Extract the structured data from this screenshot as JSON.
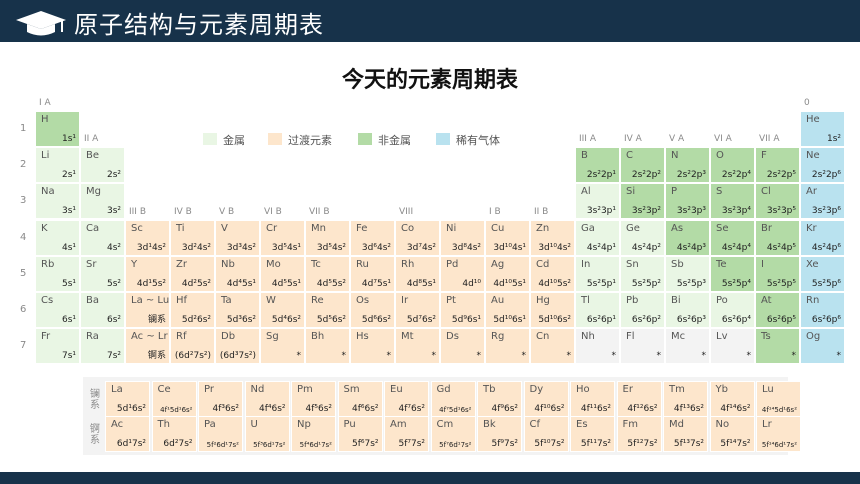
{
  "header": {
    "title": "原子结构与元素周期表"
  },
  "heading": "今天的元素周期表",
  "legend": [
    {
      "label": "金属",
      "color": "#e9f6e4"
    },
    {
      "label": "过渡元素",
      "color": "#fde6cc"
    },
    {
      "label": "非金属",
      "color": "#b3dba6"
    },
    {
      "label": "稀有气体",
      "color": "#b9e2ef"
    }
  ],
  "periods": [
    "1",
    "2",
    "3",
    "4",
    "5",
    "6",
    "7"
  ],
  "groups": [
    {
      "label": "I A",
      "col": 0,
      "row": 0
    },
    {
      "label": "II A",
      "col": 1,
      "row": 1
    },
    {
      "label": "III B",
      "col": 2,
      "row": 3
    },
    {
      "label": "IV B",
      "col": 3,
      "row": 3
    },
    {
      "label": "V B",
      "col": 4,
      "row": 3
    },
    {
      "label": "VI B",
      "col": 5,
      "row": 3
    },
    {
      "label": "VII B",
      "col": 6,
      "row": 3
    },
    {
      "label": "VIII",
      "col": 8,
      "row": 3
    },
    {
      "label": "I B",
      "col": 10,
      "row": 3
    },
    {
      "label": "II B",
      "col": 11,
      "row": 3
    },
    {
      "label": "III A",
      "col": 12,
      "row": 1
    },
    {
      "label": "IV A",
      "col": 13,
      "row": 1
    },
    {
      "label": "V A",
      "col": 14,
      "row": 1
    },
    {
      "label": "VI A",
      "col": 15,
      "row": 1
    },
    {
      "label": "VII A",
      "col": 16,
      "row": 1
    },
    {
      "label": "0",
      "col": 17,
      "row": 0
    }
  ],
  "elements": [
    {
      "s": "H",
      "c": "1s¹",
      "col": 0,
      "row": 0,
      "t": "nonmetal"
    },
    {
      "s": "He",
      "c": "1s²",
      "col": 17,
      "row": 0,
      "t": "noble"
    },
    {
      "s": "Li",
      "c": "2s¹",
      "col": 0,
      "row": 1,
      "t": "metal"
    },
    {
      "s": "Be",
      "c": "2s²",
      "col": 1,
      "row": 1,
      "t": "metal"
    },
    {
      "s": "B",
      "c": "2s²2p¹",
      "col": 12,
      "row": 1,
      "t": "nonmetal"
    },
    {
      "s": "C",
      "c": "2s²2p²",
      "col": 13,
      "row": 1,
      "t": "nonmetal"
    },
    {
      "s": "N",
      "c": "2s²2p³",
      "col": 14,
      "row": 1,
      "t": "nonmetal"
    },
    {
      "s": "O",
      "c": "2s²2p⁴",
      "col": 15,
      "row": 1,
      "t": "nonmetal"
    },
    {
      "s": "F",
      "c": "2s²2p⁵",
      "col": 16,
      "row": 1,
      "t": "nonmetal"
    },
    {
      "s": "Ne",
      "c": "2s²2p⁶",
      "col": 17,
      "row": 1,
      "t": "noble"
    },
    {
      "s": "Na",
      "c": "3s¹",
      "col": 0,
      "row": 2,
      "t": "metal"
    },
    {
      "s": "Mg",
      "c": "3s²",
      "col": 1,
      "row": 2,
      "t": "metal"
    },
    {
      "s": "Al",
      "c": "3s²3p¹",
      "col": 12,
      "row": 2,
      "t": "metal"
    },
    {
      "s": "Si",
      "c": "3s²3p²",
      "col": 13,
      "row": 2,
      "t": "nonmetal"
    },
    {
      "s": "P",
      "c": "3s²3p³",
      "col": 14,
      "row": 2,
      "t": "nonmetal"
    },
    {
      "s": "S",
      "c": "3s²3p⁴",
      "col": 15,
      "row": 2,
      "t": "nonmetal"
    },
    {
      "s": "Cl",
      "c": "3s²3p⁵",
      "col": 16,
      "row": 2,
      "t": "nonmetal"
    },
    {
      "s": "Ar",
      "c": "3s²3p⁶",
      "col": 17,
      "row": 2,
      "t": "noble"
    },
    {
      "s": "K",
      "c": "4s¹",
      "col": 0,
      "row": 3,
      "t": "metal"
    },
    {
      "s": "Ca",
      "c": "4s²",
      "col": 1,
      "row": 3,
      "t": "metal"
    },
    {
      "s": "Sc",
      "c": "3d¹4s²",
      "col": 2,
      "row": 3,
      "t": "trans"
    },
    {
      "s": "Ti",
      "c": "3d²4s²",
      "col": 3,
      "row": 3,
      "t": "trans"
    },
    {
      "s": "V",
      "c": "3d³4s²",
      "col": 4,
      "row": 3,
      "t": "trans"
    },
    {
      "s": "Cr",
      "c": "3d⁵4s¹",
      "col": 5,
      "row": 3,
      "t": "trans"
    },
    {
      "s": "Mn",
      "c": "3d⁵4s²",
      "col": 6,
      "row": 3,
      "t": "trans"
    },
    {
      "s": "Fe",
      "c": "3d⁶4s²",
      "col": 7,
      "row": 3,
      "t": "trans"
    },
    {
      "s": "Co",
      "c": "3d⁷4s²",
      "col": 8,
      "row": 3,
      "t": "trans"
    },
    {
      "s": "Ni",
      "c": "3d⁸4s²",
      "col": 9,
      "row": 3,
      "t": "trans"
    },
    {
      "s": "Cu",
      "c": "3d¹⁰4s¹",
      "col": 10,
      "row": 3,
      "t": "trans"
    },
    {
      "s": "Zn",
      "c": "3d¹⁰4s²",
      "col": 11,
      "row": 3,
      "t": "trans"
    },
    {
      "s": "Ga",
      "c": "4s²4p¹",
      "col": 12,
      "row": 3,
      "t": "metal"
    },
    {
      "s": "Ge",
      "c": "4s²4p²",
      "col": 13,
      "row": 3,
      "t": "metal"
    },
    {
      "s": "As",
      "c": "4s²4p³",
      "col": 14,
      "row": 3,
      "t": "nonmetal"
    },
    {
      "s": "Se",
      "c": "4s²4p⁴",
      "col": 15,
      "row": 3,
      "t": "nonmetal"
    },
    {
      "s": "Br",
      "c": "4s²4p⁵",
      "col": 16,
      "row": 3,
      "t": "nonmetal"
    },
    {
      "s": "Kr",
      "c": "4s²4p⁶",
      "col": 17,
      "row": 3,
      "t": "noble"
    },
    {
      "s": "Rb",
      "c": "5s¹",
      "col": 0,
      "row": 4,
      "t": "metal"
    },
    {
      "s": "Sr",
      "c": "5s²",
      "col": 1,
      "row": 4,
      "t": "metal"
    },
    {
      "s": "Y",
      "c": "4d¹5s²",
      "col": 2,
      "row": 4,
      "t": "trans"
    },
    {
      "s": "Zr",
      "c": "4d²5s²",
      "col": 3,
      "row": 4,
      "t": "trans"
    },
    {
      "s": "Nb",
      "c": "4d⁴5s¹",
      "col": 4,
      "row": 4,
      "t": "trans"
    },
    {
      "s": "Mo",
      "c": "4d⁵5s¹",
      "col": 5,
      "row": 4,
      "t": "trans"
    },
    {
      "s": "Tc",
      "c": "4d⁵5s²",
      "col": 6,
      "row": 4,
      "t": "trans"
    },
    {
      "s": "Ru",
      "c": "4d⁷5s¹",
      "col": 7,
      "row": 4,
      "t": "trans"
    },
    {
      "s": "Rh",
      "c": "4d⁸5s¹",
      "col": 8,
      "row": 4,
      "t": "trans"
    },
    {
      "s": "Pd",
      "c": "4d¹⁰",
      "col": 9,
      "row": 4,
      "t": "trans"
    },
    {
      "s": "Ag",
      "c": "4d¹⁰5s¹",
      "col": 10,
      "row": 4,
      "t": "trans"
    },
    {
      "s": "Cd",
      "c": "4d¹⁰5s²",
      "col": 11,
      "row": 4,
      "t": "trans"
    },
    {
      "s": "In",
      "c": "5s²5p¹",
      "col": 12,
      "row": 4,
      "t": "metal"
    },
    {
      "s": "Sn",
      "c": "5s²5p²",
      "col": 13,
      "row": 4,
      "t": "metal"
    },
    {
      "s": "Sb",
      "c": "5s²5p³",
      "col": 14,
      "row": 4,
      "t": "metal"
    },
    {
      "s": "Te",
      "c": "5s²5p⁴",
      "col": 15,
      "row": 4,
      "t": "nonmetal"
    },
    {
      "s": "I",
      "c": "5s²5p⁵",
      "col": 16,
      "row": 4,
      "t": "nonmetal"
    },
    {
      "s": "Xe",
      "c": "5s²5p⁶",
      "col": 17,
      "row": 4,
      "t": "noble"
    },
    {
      "s": "Cs",
      "c": "6s¹",
      "col": 0,
      "row": 5,
      "t": "metal"
    },
    {
      "s": "Ba",
      "c": "6s²",
      "col": 1,
      "row": 5,
      "t": "metal"
    },
    {
      "s": "La ~ Lu",
      "c": "镧系",
      "col": 2,
      "row": 5,
      "t": "trans"
    },
    {
      "s": "Hf",
      "c": "5d²6s²",
      "col": 3,
      "row": 5,
      "t": "trans"
    },
    {
      "s": "Ta",
      "c": "5d³6s²",
      "col": 4,
      "row": 5,
      "t": "trans"
    },
    {
      "s": "W",
      "c": "5d⁴6s²",
      "col": 5,
      "row": 5,
      "t": "trans"
    },
    {
      "s": "Re",
      "c": "5d⁵6s²",
      "col": 6,
      "row": 5,
      "t": "trans"
    },
    {
      "s": "Os",
      "c": "5d⁶6s²",
      "col": 7,
      "row": 5,
      "t": "trans"
    },
    {
      "s": "Ir",
      "c": "5d⁷6s²",
      "col": 8,
      "row": 5,
      "t": "trans"
    },
    {
      "s": "Pt",
      "c": "5d⁹6s¹",
      "col": 9,
      "row": 5,
      "t": "trans"
    },
    {
      "s": "Au",
      "c": "5d¹⁰6s¹",
      "col": 10,
      "row": 5,
      "t": "trans"
    },
    {
      "s": "Hg",
      "c": "5d¹⁰6s²",
      "col": 11,
      "row": 5,
      "t": "trans"
    },
    {
      "s": "Tl",
      "c": "6s²6p¹",
      "col": 12,
      "row": 5,
      "t": "metal"
    },
    {
      "s": "Pb",
      "c": "6s²6p²",
      "col": 13,
      "row": 5,
      "t": "metal"
    },
    {
      "s": "Bi",
      "c": "6s²6p³",
      "col": 14,
      "row": 5,
      "t": "metal"
    },
    {
      "s": "Po",
      "c": "6s²6p⁴",
      "col": 15,
      "row": 5,
      "t": "metal"
    },
    {
      "s": "At",
      "c": "6s²6p⁵",
      "col": 16,
      "row": 5,
      "t": "nonmetal"
    },
    {
      "s": "Rn",
      "c": "6s²6p⁶",
      "col": 17,
      "row": 5,
      "t": "noble"
    },
    {
      "s": "Fr",
      "c": "7s¹",
      "col": 0,
      "row": 6,
      "t": "metal"
    },
    {
      "s": "Ra",
      "c": "7s²",
      "col": 1,
      "row": 6,
      "t": "metal"
    },
    {
      "s": "Ac ~ Lr",
      "c": "锕系",
      "col": 2,
      "row": 6,
      "t": "trans"
    },
    {
      "s": "Rf",
      "c": "(6d²7s²)",
      "col": 3,
      "row": 6,
      "t": "trans"
    },
    {
      "s": "Db",
      "c": "(6d³7s²)",
      "col": 4,
      "row": 6,
      "t": "trans"
    },
    {
      "s": "Sg",
      "c": "*",
      "col": 5,
      "row": 6,
      "t": "trans"
    },
    {
      "s": "Bh",
      "c": "*",
      "col": 6,
      "row": 6,
      "t": "trans"
    },
    {
      "s": "Hs",
      "c": "*",
      "col": 7,
      "row": 6,
      "t": "trans"
    },
    {
      "s": "Mt",
      "c": "*",
      "col": 8,
      "row": 6,
      "t": "trans"
    },
    {
      "s": "Ds",
      "c": "*",
      "col": 9,
      "row": 6,
      "t": "trans"
    },
    {
      "s": "Rg",
      "c": "*",
      "col": 10,
      "row": 6,
      "t": "trans"
    },
    {
      "s": "Cn",
      "c": "*",
      "col": 11,
      "row": 6,
      "t": "trans"
    },
    {
      "s": "Nh",
      "c": "*",
      "col": 12,
      "row": 6,
      "t": "empty"
    },
    {
      "s": "Fl",
      "c": "*",
      "col": 13,
      "row": 6,
      "t": "empty"
    },
    {
      "s": "Mc",
      "c": "*",
      "col": 14,
      "row": 6,
      "t": "empty"
    },
    {
      "s": "Lv",
      "c": "*",
      "col": 15,
      "row": 6,
      "t": "empty"
    },
    {
      "s": "Ts",
      "c": "*",
      "col": 16,
      "row": 6,
      "t": "nonmetal"
    },
    {
      "s": "Og",
      "c": "*",
      "col": 17,
      "row": 6,
      "t": "noble"
    }
  ],
  "f_block": {
    "lanthanide_label": "镧系",
    "actinide_label": "锕系",
    "lanthanides": [
      {
        "s": "La",
        "c": "5d¹6s²"
      },
      {
        "s": "Ce",
        "c": "4f¹5d¹6s²",
        "small": true
      },
      {
        "s": "Pr",
        "c": "4f³6s²"
      },
      {
        "s": "Nd",
        "c": "4f⁴6s²"
      },
      {
        "s": "Pm",
        "c": "4f⁵6s²"
      },
      {
        "s": "Sm",
        "c": "4f⁶6s²"
      },
      {
        "s": "Eu",
        "c": "4f⁷6s²"
      },
      {
        "s": "Gd",
        "c": "4f⁷5d¹6s²",
        "small": true
      },
      {
        "s": "Tb",
        "c": "4f⁹6s²"
      },
      {
        "s": "Dy",
        "c": "4f¹⁰6s²"
      },
      {
        "s": "Ho",
        "c": "4f¹¹6s²"
      },
      {
        "s": "Er",
        "c": "4f¹²6s²"
      },
      {
        "s": "Tm",
        "c": "4f¹³6s²"
      },
      {
        "s": "Yb",
        "c": "4f¹⁴6s²"
      },
      {
        "s": "Lu",
        "c": "4f¹⁴5d¹6s²",
        "small": true
      }
    ],
    "actinides": [
      {
        "s": "Ac",
        "c": "6d¹7s²"
      },
      {
        "s": "Th",
        "c": "6d²7s²"
      },
      {
        "s": "Pa",
        "c": "5f²6d¹7s²",
        "small": true
      },
      {
        "s": "U",
        "c": "5f³6d¹7s²",
        "small": true
      },
      {
        "s": "Np",
        "c": "5f⁴6d¹7s²",
        "small": true
      },
      {
        "s": "Pu",
        "c": "5f⁶7s²"
      },
      {
        "s": "Am",
        "c": "5f⁷7s²"
      },
      {
        "s": "Cm",
        "c": "5f⁷6d¹7s²",
        "small": true
      },
      {
        "s": "Bk",
        "c": "5f⁹7s²"
      },
      {
        "s": "Cf",
        "c": "5f¹⁰7s²"
      },
      {
        "s": "Es",
        "c": "5f¹¹7s²"
      },
      {
        "s": "Fm",
        "c": "5f¹²7s²"
      },
      {
        "s": "Md",
        "c": "5f¹³7s²"
      },
      {
        "s": "No",
        "c": "5f¹⁴7s²"
      },
      {
        "s": "Lr",
        "c": "5f¹⁴6d¹7s²",
        "small": true
      }
    ]
  }
}
